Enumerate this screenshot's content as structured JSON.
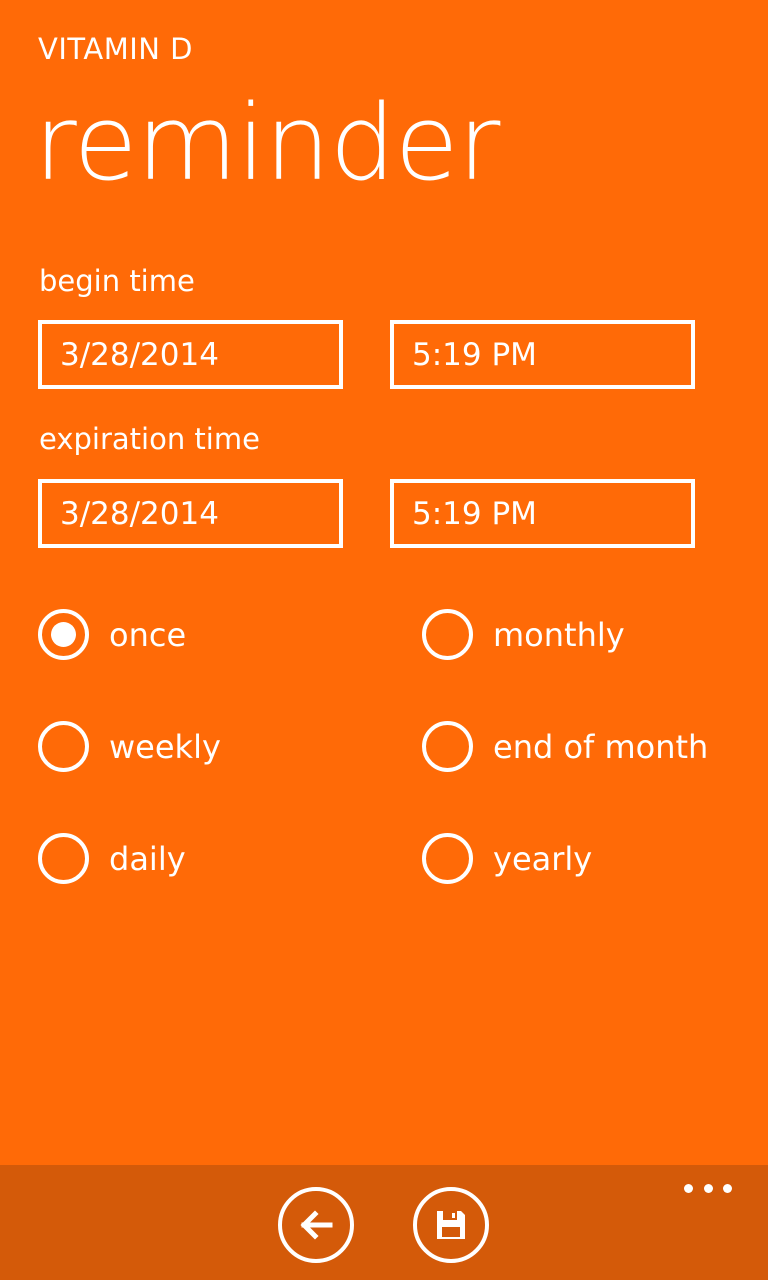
{
  "header": {
    "app_title": "VITAMIN D",
    "page_title": "reminder"
  },
  "begin": {
    "label": "begin time",
    "date": "3/28/2014",
    "time": "5:19 PM"
  },
  "expiration": {
    "label": "expiration time",
    "date": "3/28/2014",
    "time": "5:19 PM"
  },
  "recurrence": {
    "selected": "once",
    "options": [
      "once",
      "monthly",
      "weekly",
      "end of month",
      "daily",
      "yearly"
    ]
  },
  "appbar": {
    "icons": [
      "back-arrow-icon",
      "save-icon",
      "more-icon"
    ]
  },
  "colors": {
    "accent": "#FF6A07",
    "appbar": "#D45A09",
    "foreground": "#FFFFFF"
  }
}
